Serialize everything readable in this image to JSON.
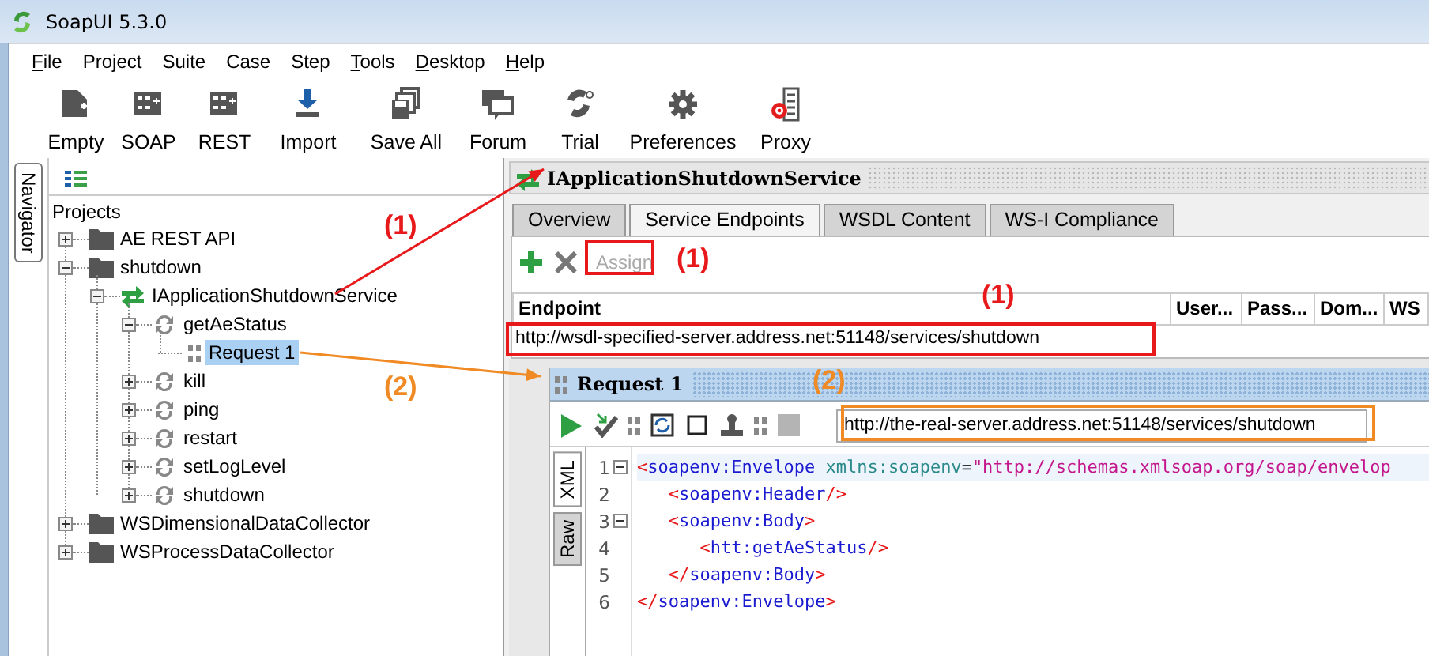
{
  "window": {
    "title": "SoapUI 5.3.0"
  },
  "menu": [
    {
      "label": "File",
      "underlined": true
    },
    {
      "label": "Project",
      "underlined": false
    },
    {
      "label": "Suite",
      "underlined": false
    },
    {
      "label": "Case",
      "underlined": false
    },
    {
      "label": "Step",
      "underlined": false
    },
    {
      "label": "Tools",
      "underlined": true
    },
    {
      "label": "Desktop",
      "underlined": true
    },
    {
      "label": "Help",
      "underlined": true
    }
  ],
  "toolbar": [
    {
      "label": "Empty",
      "kind": "empty"
    },
    {
      "label": "SOAP",
      "kind": "soap"
    },
    {
      "label": "REST",
      "kind": "rest"
    },
    {
      "label": "Import",
      "kind": "import"
    },
    {
      "label": "Save All",
      "kind": "saveall"
    },
    {
      "label": "Forum",
      "kind": "forum"
    },
    {
      "label": "Trial",
      "kind": "trial"
    },
    {
      "label": "Preferences",
      "kind": "preferences"
    },
    {
      "label": "Proxy",
      "kind": "proxy"
    }
  ],
  "navigator": {
    "tab": "Navigator",
    "root": "Projects",
    "items": [
      {
        "label": "AE REST API",
        "kind": "project",
        "expanded": false,
        "selected": false
      },
      {
        "label": "shutdown",
        "kind": "project",
        "expanded": true,
        "selected": false,
        "children": [
          {
            "label": "IApplicationShutdownService",
            "kind": "service",
            "expanded": true,
            "selected": false,
            "children": [
              {
                "label": "getAeStatus",
                "kind": "operation",
                "expanded": true,
                "selected": false,
                "children": [
                  {
                    "label": "Request 1",
                    "kind": "request",
                    "selected": true
                  }
                ]
              },
              {
                "label": "kill",
                "kind": "operation",
                "expanded": false,
                "selected": false
              },
              {
                "label": "ping",
                "kind": "operation",
                "expanded": false,
                "selected": false
              },
              {
                "label": "restart",
                "kind": "operation",
                "expanded": false,
                "selected": false
              },
              {
                "label": "setLogLevel",
                "kind": "operation",
                "expanded": false,
                "selected": false
              },
              {
                "label": "shutdown",
                "kind": "operation",
                "expanded": false,
                "selected": false
              }
            ]
          }
        ]
      },
      {
        "label": "WSDimensionalDataCollector",
        "kind": "project",
        "expanded": false,
        "selected": false
      },
      {
        "label": "WSProcessDataCollector",
        "kind": "project",
        "expanded": false,
        "selected": false
      }
    ]
  },
  "service": {
    "title": "IApplicationShutdownService",
    "tabs": [
      {
        "label": "Overview",
        "selected": false
      },
      {
        "label": "Service Endpoints",
        "selected": true
      },
      {
        "label": "WSDL Content",
        "selected": false
      },
      {
        "label": "WS-I Compliance",
        "selected": false
      }
    ],
    "assign": {
      "label": "Assign",
      "disabled": true
    },
    "table": {
      "columns": [
        "Endpoint",
        "User...",
        "Pass...",
        "Dom...",
        "WS"
      ],
      "rows": [
        [
          "http://wsdl-specified-server.address.net:51148/services/shutdown"
        ]
      ]
    }
  },
  "request": {
    "title": "Request 1",
    "url": "http://the-real-server.address.net:51148/services/shutdown",
    "tabs": [
      {
        "label": "XML",
        "selected": true
      },
      {
        "label": "Raw",
        "selected": false
      }
    ],
    "lines": [
      {
        "number": "1",
        "fold": true,
        "current": true,
        "tokens": [
          {
            "text": "<",
            "kind": "bracket"
          },
          {
            "text": "soapenv:Envelope",
            "kind": "tag"
          },
          {
            "text": " xmlns:soapenv",
            "kind": "attr"
          },
          {
            "text": "=",
            "kind": "equals"
          },
          {
            "text": "\"http://schemas.xmlsoap.org/soap/envelop",
            "kind": "string"
          }
        ]
      },
      {
        "number": "2",
        "fold": false,
        "current": false,
        "tokens": [
          {
            "text": "   <",
            "kind": "bracket"
          },
          {
            "text": "soapenv:Header",
            "kind": "tag"
          },
          {
            "text": "/>",
            "kind": "bracket"
          }
        ]
      },
      {
        "number": "3",
        "fold": true,
        "current": false,
        "tokens": [
          {
            "text": "   <",
            "kind": "bracket"
          },
          {
            "text": "soapenv:Body",
            "kind": "tag"
          },
          {
            "text": ">",
            "kind": "bracket"
          }
        ]
      },
      {
        "number": "4",
        "fold": false,
        "current": false,
        "tokens": [
          {
            "text": "      <",
            "kind": "bracket"
          },
          {
            "text": "htt:getAeStatus",
            "kind": "tag"
          },
          {
            "text": "/>",
            "kind": "bracket"
          }
        ]
      },
      {
        "number": "5",
        "fold": false,
        "current": false,
        "tokens": [
          {
            "text": "   </",
            "kind": "bracket"
          },
          {
            "text": "soapenv:Body",
            "kind": "tag"
          },
          {
            "text": ">",
            "kind": "bracket"
          }
        ]
      },
      {
        "number": "6",
        "fold": false,
        "current": false,
        "tokens": [
          {
            "text": "</",
            "kind": "bracket"
          },
          {
            "text": "soapenv:Envelope",
            "kind": "tag"
          },
          {
            "text": ">",
            "kind": "bracket"
          }
        ]
      }
    ]
  },
  "annotations": [
    {
      "kind": "arrow",
      "color": "#e8191a"
    },
    {
      "kind": "arrow",
      "color": "#f08a24"
    },
    {
      "kind": "label",
      "text": "(1)",
      "color": "#e8191a"
    },
    {
      "kind": "label",
      "text": "(1)",
      "color": "#e8191a"
    },
    {
      "kind": "label",
      "text": "(1)",
      "color": "#e8191a"
    },
    {
      "kind": "label",
      "text": "(2)",
      "color": "#f08a24"
    },
    {
      "kind": "label",
      "text": "(2)",
      "color": "#f08a24"
    },
    {
      "kind": "box",
      "color": "#e8191a"
    },
    {
      "kind": "box",
      "color": "#e8191a"
    },
    {
      "kind": "box",
      "color": "#f08a24"
    }
  ]
}
